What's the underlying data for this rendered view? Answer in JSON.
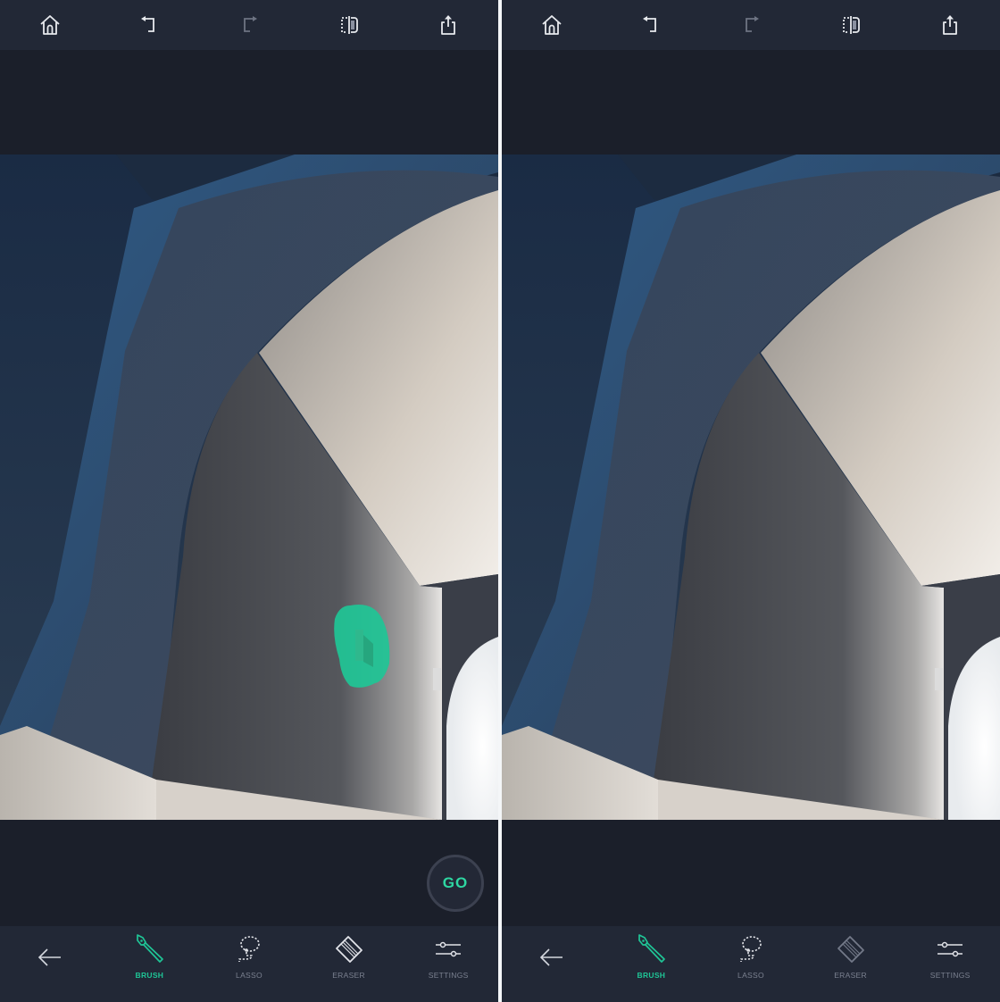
{
  "app": {
    "accent_color": "#1fc596",
    "go_color": "#2ed7a2"
  },
  "panels": [
    {
      "id": "before",
      "topbar": {
        "icons": [
          "home-icon",
          "undo-icon",
          "redo-icon",
          "compare-icon",
          "share-icon"
        ]
      },
      "selection_mask": {
        "visible": true,
        "color": "#1fc596"
      },
      "go_button": {
        "label": "GO",
        "visible": true
      },
      "toolbar": {
        "back_icon": "arrow-left-icon",
        "tools": [
          {
            "label": "BRUSH",
            "icon": "brush-icon",
            "active": true
          },
          {
            "label": "LASSO",
            "icon": "lasso-icon",
            "active": false
          },
          {
            "label": "ERASER",
            "icon": "eraser-icon",
            "active": false
          },
          {
            "label": "SETTINGS",
            "icon": "sliders-icon",
            "active": false
          }
        ]
      }
    },
    {
      "id": "after",
      "topbar": {
        "icons": [
          "home-icon",
          "undo-icon",
          "redo-icon",
          "compare-icon",
          "share-icon"
        ]
      },
      "selection_mask": {
        "visible": false
      },
      "toolbar": {
        "back_icon": "arrow-left-icon",
        "tools": [
          {
            "label": "BRUSH",
            "icon": "brush-icon",
            "active": true
          },
          {
            "label": "LASSO",
            "icon": "lasso-icon",
            "active": false
          },
          {
            "label": "ERASER",
            "icon": "eraser-icon",
            "active": false,
            "disabled": true
          },
          {
            "label": "SETTINGS",
            "icon": "sliders-icon",
            "active": false
          }
        ]
      }
    }
  ]
}
